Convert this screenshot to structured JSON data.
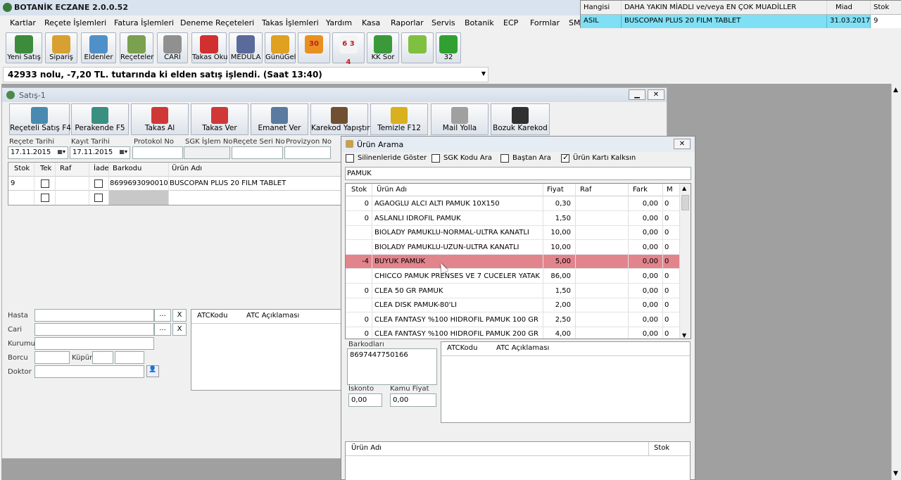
{
  "app": {
    "title": "BOTANİK ECZANE 2.0.0.52"
  },
  "menu": [
    "Kartlar",
    "Reçete İşlemleri",
    "Fatura İşlemleri",
    "Deneme Reçeteleri",
    "Takas İşlemleri",
    "Yardım",
    "Kasa",
    "Raporlar",
    "Servis",
    "Botanik",
    "ECP",
    "Formlar",
    "SM"
  ],
  "toolbar": [
    {
      "label": "Yeni Satış",
      "icon": "pill-bottle-icon",
      "color": "#3c8c3c"
    },
    {
      "label": "Sipariş",
      "icon": "cart-icon",
      "color": "#d8a030"
    },
    {
      "label": "Eldenler",
      "icon": "hand-pills-icon",
      "color": "#5090c8"
    },
    {
      "label": "Reçeteler",
      "icon": "prescription-icon",
      "color": "#7aa050"
    },
    {
      "label": "CARİ",
      "icon": "calculator-icon",
      "color": "#909090"
    },
    {
      "label": "Takas Oku",
      "icon": "exchange-icon",
      "color": "#d03030"
    },
    {
      "label": "MEDULA",
      "icon": "medula-icon",
      "color": "#5a6a9a"
    },
    {
      "label": "GünüGel",
      "icon": "clock-icon",
      "color": "#e0a020"
    },
    {
      "label": "",
      "icon": "calendar-30-icon",
      "badge": "30",
      "color": "#e89020"
    },
    {
      "label": "",
      "icon": "calendar-634-icon",
      "badge": "6 3 4",
      "color": "#f4f4f4"
    },
    {
      "label": "KK Sor",
      "icon": "check-icon",
      "color": "#3a9a3a"
    },
    {
      "label": "",
      "icon": "help-icon",
      "color": "#80c040"
    },
    {
      "label": "32",
      "icon": "up-down-arrow-icon",
      "color": "#30a030"
    }
  ],
  "status_message": "42933 nolu, -7,20 TL. tutarında ki elden satış işlendi. (Saat 13:40)",
  "muadil": {
    "headers": [
      "Hangisi",
      "DAHA YAKIN MİADLI ve/veya EN ÇOK MUADİLLER",
      "Miad",
      "Stok"
    ],
    "row": [
      "ASIL",
      "BUSCOPAN PLUS 20 FILM TABLET",
      "31.03.2017",
      "9"
    ]
  },
  "satis": {
    "title": "Satış-1",
    "buttons": [
      {
        "label": "Reçeteli Satış F4",
        "icon": "prescription-sale-icon",
        "color": "#4a8ab0"
      },
      {
        "label": "Perakende F5",
        "icon": "retail-icon",
        "color": "#3a9080"
      },
      {
        "label": "Takas Al",
        "icon": "exchange-in-icon",
        "color": "#d03838"
      },
      {
        "label": "Takas Ver",
        "icon": "exchange-out-icon",
        "color": "#d03838"
      },
      {
        "label": "Emanet Ver",
        "icon": "person-icon",
        "color": "#5a7aa0"
      },
      {
        "label": "Karekod Yapıştır",
        "icon": "barcode-box-icon",
        "color": "#705030"
      },
      {
        "label": "Temizle F12",
        "icon": "broom-icon",
        "color": "#d8b020"
      },
      {
        "label": "Mail Yolla",
        "icon": "mail-icon",
        "color": "#a0a0a0"
      },
      {
        "label": "Bozuk Karekod",
        "icon": "qr-code-icon",
        "color": "#303030"
      }
    ],
    "fields": {
      "recete_tarihi_label": "Reçete Tarihi",
      "recete_tarihi": "17.11.2015",
      "kayit_tarihi_label": "Kayıt Tarihi",
      "kayit_tarihi": "17.11.2015",
      "protokol_label": "Protokol No",
      "sgk_label": "SGK İşlem No",
      "recete_seri_label": "Reçete Seri No",
      "provizyon_label": "Provizyon No"
    },
    "grid_headers": [
      "Stok",
      "Tek",
      "Raf",
      "İade",
      "Barkodu",
      "Ürün Adı"
    ],
    "grid_rows": [
      {
        "stok": "9",
        "barkod": "8699693090010",
        "urun": "BUSCOPAN PLUS 20 FILM TABLET"
      }
    ],
    "patient": {
      "hasta": "Hasta",
      "cari": "Cari",
      "kurumu": "Kurumu",
      "borcu": "Borcu",
      "kupur": "Küpür",
      "doktor": "Doktor",
      "dots": "...",
      "x": "X"
    },
    "atc_headers": [
      "ATCKodu",
      "ATC Açıklaması"
    ]
  },
  "urun_arama": {
    "title": "Ürün Arama",
    "options": [
      {
        "label": "Silinenleride Göster",
        "checked": false
      },
      {
        "label": "SGK Kodu Ara",
        "checked": false
      },
      {
        "label": "Baştan Ara",
        "checked": false
      },
      {
        "label": "Ürün Kartı Kalksın",
        "checked": true
      }
    ],
    "search_value": "PAMUK",
    "headers": [
      "Stok",
      "Ürün Adı",
      "Fiyat",
      "Raf",
      "Fark",
      "M"
    ],
    "rows": [
      {
        "stok": "0",
        "ad": "AGAOGLU ALCI ALTI PAMUK 10X150",
        "fiyat": "0,30",
        "fark": "0,00",
        "m": "0"
      },
      {
        "stok": "0",
        "ad": "ASLANLI İDROFİL PAMUK",
        "fiyat": "1,50",
        "fark": "0,00",
        "m": "0"
      },
      {
        "stok": "",
        "ad": "BİOLADY PAMUKLU-NORMAL-ULTRA KANATLI",
        "fiyat": "10,00",
        "fark": "0,00",
        "m": "0"
      },
      {
        "stok": "",
        "ad": "BİOLADY PAMUKLU-UZUN-ULTRA KANATLI",
        "fiyat": "10,00",
        "fark": "0,00",
        "m": "0"
      },
      {
        "stok": "-4",
        "ad": "BÜYÜK PAMUK",
        "fiyat": "5,00",
        "fark": "0,00",
        "m": "0",
        "selected": true
      },
      {
        "stok": "",
        "ad": "CHICCO PAMUK PRENSES VE 7 CÜCELER YATAK ...",
        "fiyat": "86,00",
        "fark": "0,00",
        "m": "0"
      },
      {
        "stok": "0",
        "ad": "CLEA 50 GR PAMUK",
        "fiyat": "1,50",
        "fark": "0,00",
        "m": "0"
      },
      {
        "stok": "",
        "ad": "CLEA DISK PAMUK-80'Lİ",
        "fiyat": "2,00",
        "fark": "0,00",
        "m": "0"
      },
      {
        "stok": "0",
        "ad": "CLEA FANTASY %100 HİDROFİL PAMUK 100 GR",
        "fiyat": "2,50",
        "fark": "0,00",
        "m": "0"
      },
      {
        "stok": "0",
        "ad": "CLEA FANTASY %100 HİDROFİL PAMUK 200 GR",
        "fiyat": "4,00",
        "fark": "0,00",
        "m": "0"
      }
    ],
    "barkodlari_label": "Barkodları",
    "barkod_value": "8697447750166",
    "iskonto_label": "İskonto",
    "iskonto_value": "0,00",
    "kamu_fiyat_label": "Kamu Fiyat",
    "kamu_fiyat_value": "0,00",
    "atc_headers": [
      "ATCKodu",
      "ATC Açıklaması"
    ],
    "bottom_headers": [
      "Ürün Adı",
      "Stok"
    ]
  }
}
